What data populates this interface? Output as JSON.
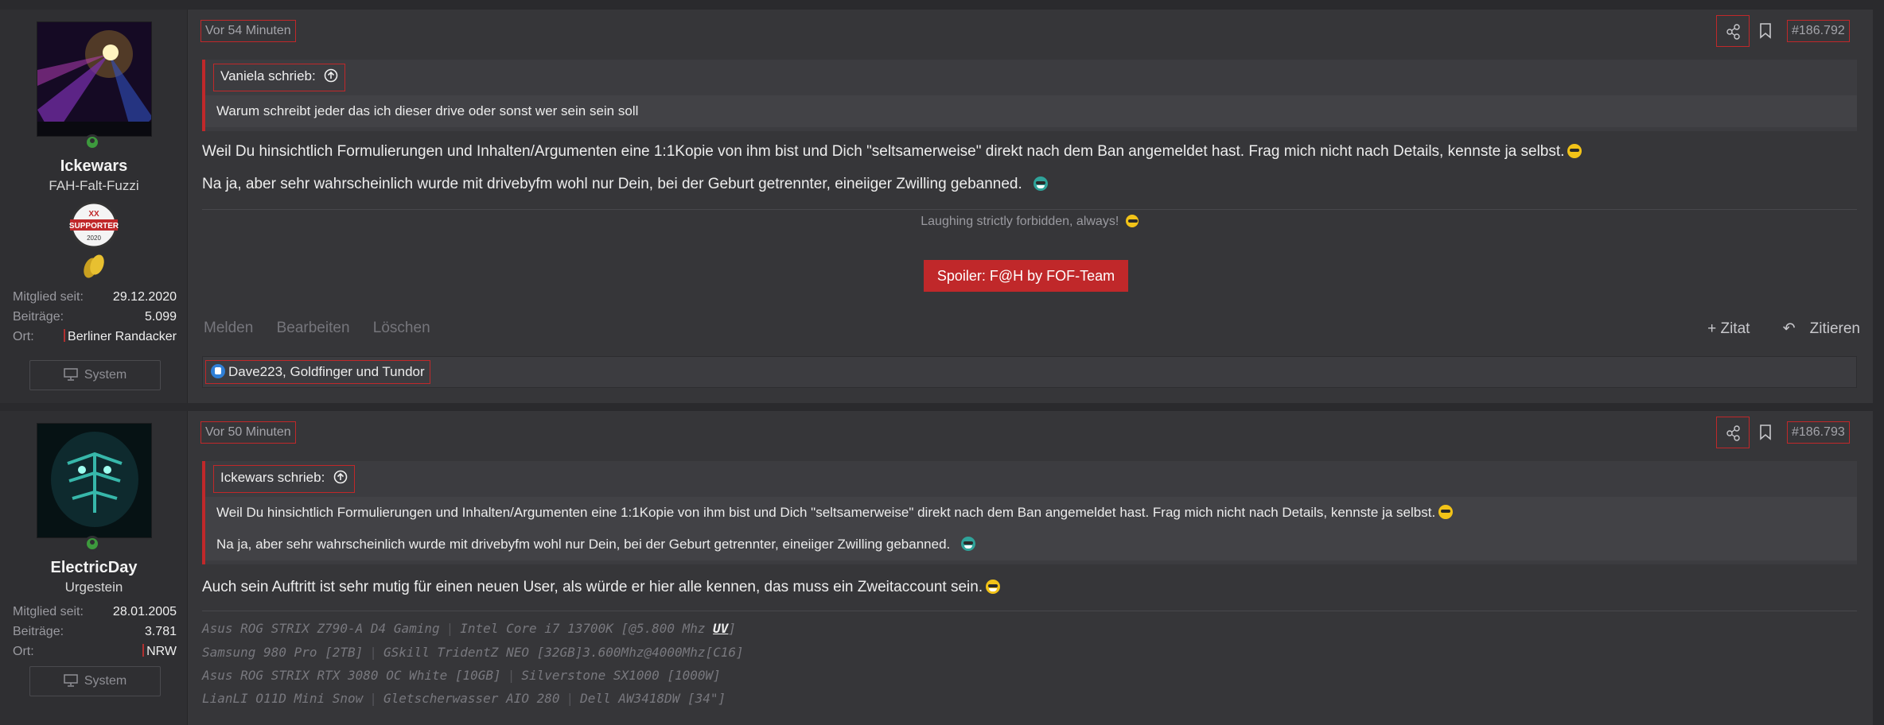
{
  "posts": [
    {
      "user": {
        "name": "Ickewars",
        "title": "FAH-Falt-Fuzzi",
        "badge_top": "XX",
        "badge_text": "SUPPORTER",
        "badge_year": "2020",
        "stats": [
          {
            "key": "Mitglied seit:",
            "value": "29.12.2020"
          },
          {
            "key": "Beiträge:",
            "value": "5.099"
          },
          {
            "key": "Ort:",
            "value": "Berliner Randacker"
          }
        ],
        "system_label": "System"
      },
      "time": "Vor 54 Minuten",
      "post_number": "#186.792",
      "quote": {
        "author": "Vaniela schrieb:",
        "lines": [
          "Warum schreibt jeder das ich dieser drive oder sonst wer sein sein soll"
        ]
      },
      "body": [
        "Weil Du hinsichtlich Formulierungen und Inhalten/Argumenten eine 1:1Kopie von ihm bist und Dich \"seltsamerweise\" direkt nach dem Ban angemeldet hast. Frag mich nicht nach Details, kennste ja selbst.",
        "Na ja, aber sehr wahrscheinlich wurde mit drivebyfm wohl nur Dein, bei der Geburt getrennter, eineiiger Zwilling gebanned."
      ],
      "signature": "Laughing strictly forbidden, always!",
      "spoiler": "Spoiler: F@H by FOF-Team",
      "actions_left": [
        "Melden",
        "Bearbeiten",
        "Löschen"
      ],
      "actions_right": [
        "+ Zitat",
        "Zitieren"
      ],
      "reactions": "Dave223, Goldfinger und Tundor"
    },
    {
      "user": {
        "name": "ElectricDay",
        "title": "Urgestein",
        "stats": [
          {
            "key": "Mitglied seit:",
            "value": "28.01.2005"
          },
          {
            "key": "Beiträge:",
            "value": "3.781"
          },
          {
            "key": "Ort:",
            "value": "NRW"
          }
        ],
        "system_label": "System"
      },
      "time": "Vor 50 Minuten",
      "post_number": "#186.793",
      "quote": {
        "author": "Ickewars schrieb:",
        "lines": [
          "Weil Du hinsichtlich Formulierungen und Inhalten/Argumenten eine 1:1Kopie von ihm bist und Dich \"seltsamerweise\" direkt nach dem Ban angemeldet hast. Frag mich nicht nach Details, kennste ja selbst.",
          "Na ja, aber sehr wahrscheinlich wurde mit drivebyfm wohl nur Dein, bei der Geburt getrennter, eineiiger Zwilling gebanned."
        ]
      },
      "body": [
        "Auch sein Auftritt ist sehr mutig für einen neuen User, als würde er hier alle kennen, das muss ein Zweitaccount sein."
      ],
      "signature_lines": [
        [
          "Asus ROG STRIX Z790-A D4 Gaming",
          "Intel Core i7 13700K [@5.800 Mhz",
          "UV",
          "]"
        ],
        [
          "Samsung 980 Pro [2TB]",
          "GSkill TridentZ NEO [32GB]3.600Mhz@4000Mhz[C16]"
        ],
        [
          "Asus ROG STRIX RTX 3080 OC White [10GB]",
          "Silverstone SX1000 [1000W]"
        ],
        [
          "LianLI O11D Mini Snow",
          "Gletscherwasser AIO 280",
          "Dell AW3418DW [34\"]"
        ]
      ]
    }
  ],
  "colors": {
    "accent": "#c0282a",
    "online": "#3d9a3d",
    "like": "#2f7fd6"
  },
  "icons": [
    "share-icon",
    "bookmark-icon",
    "monitor-icon",
    "arrow-up-circle-icon",
    "like-icon",
    "reply-icon"
  ]
}
